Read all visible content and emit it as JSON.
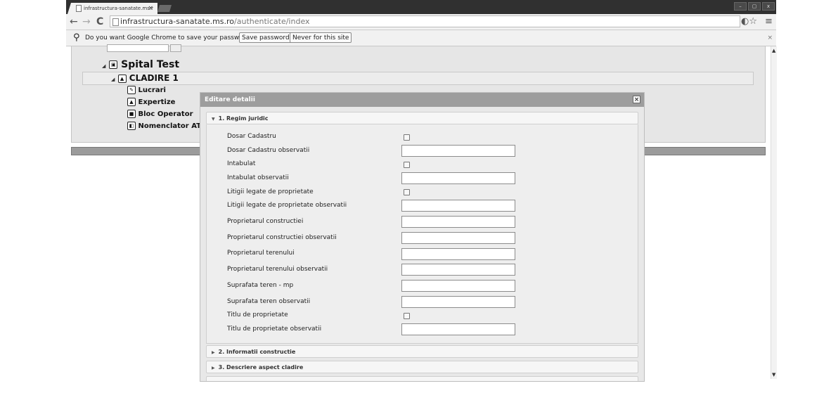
{
  "browser": {
    "tab_title": "infrastructura-sanatate.ms.r",
    "tab_close": "×",
    "back": "←",
    "forward": "→",
    "reload": "C",
    "url_host": "infrastructura-sanatate.ms.ro",
    "url_path": "/authenticate/index",
    "right_icons": "◐☆",
    "menu_icon": "≡",
    "window_buttons": [
      "–",
      "▢",
      "x"
    ]
  },
  "infobar": {
    "message": "Do you want Google Chrome to save your password?",
    "save_button": "Save password",
    "never_button": "Never for this site",
    "close": "×"
  },
  "tree": {
    "root": "Spital Test",
    "building": "CLADIRE 1",
    "items": [
      "Lucrari",
      "Expertize",
      "Bloc Operator",
      "Nomenclator ATI"
    ]
  },
  "dialog": {
    "title": "Editare detalii",
    "close": "×",
    "section1": "1. Regim juridic",
    "fields": [
      {
        "label": "Dosar Cadastru",
        "type": "checkbox"
      },
      {
        "label": "Dosar Cadastru observatii",
        "type": "text",
        "value": ""
      },
      {
        "label": "Intabulat",
        "type": "checkbox"
      },
      {
        "label": "Intabulat observatii",
        "type": "text",
        "value": ""
      },
      {
        "label": "Litigii legate de proprietate",
        "type": "checkbox"
      },
      {
        "label": "Litigii legate de proprietate observatii",
        "type": "text",
        "value": ""
      },
      {
        "label": "Proprietarul constructiei",
        "type": "text",
        "value": ""
      },
      {
        "label": "Proprietarul constructiei observatii",
        "type": "text",
        "value": ""
      },
      {
        "label": "Proprietarul terenului",
        "type": "text",
        "value": ""
      },
      {
        "label": "Proprietarul terenului observatii",
        "type": "text",
        "value": ""
      },
      {
        "label": "Suprafata teren - mp",
        "type": "text",
        "value": ""
      },
      {
        "label": "Suprafata teren observatii",
        "type": "text",
        "value": ""
      },
      {
        "label": "Titlu de proprietate",
        "type": "checkbox"
      },
      {
        "label": "Titlu de proprietate observatii",
        "type": "text",
        "value": ""
      }
    ],
    "section2": "2. Informatii constructie",
    "section3": "3. Descriere aspect cladire"
  }
}
